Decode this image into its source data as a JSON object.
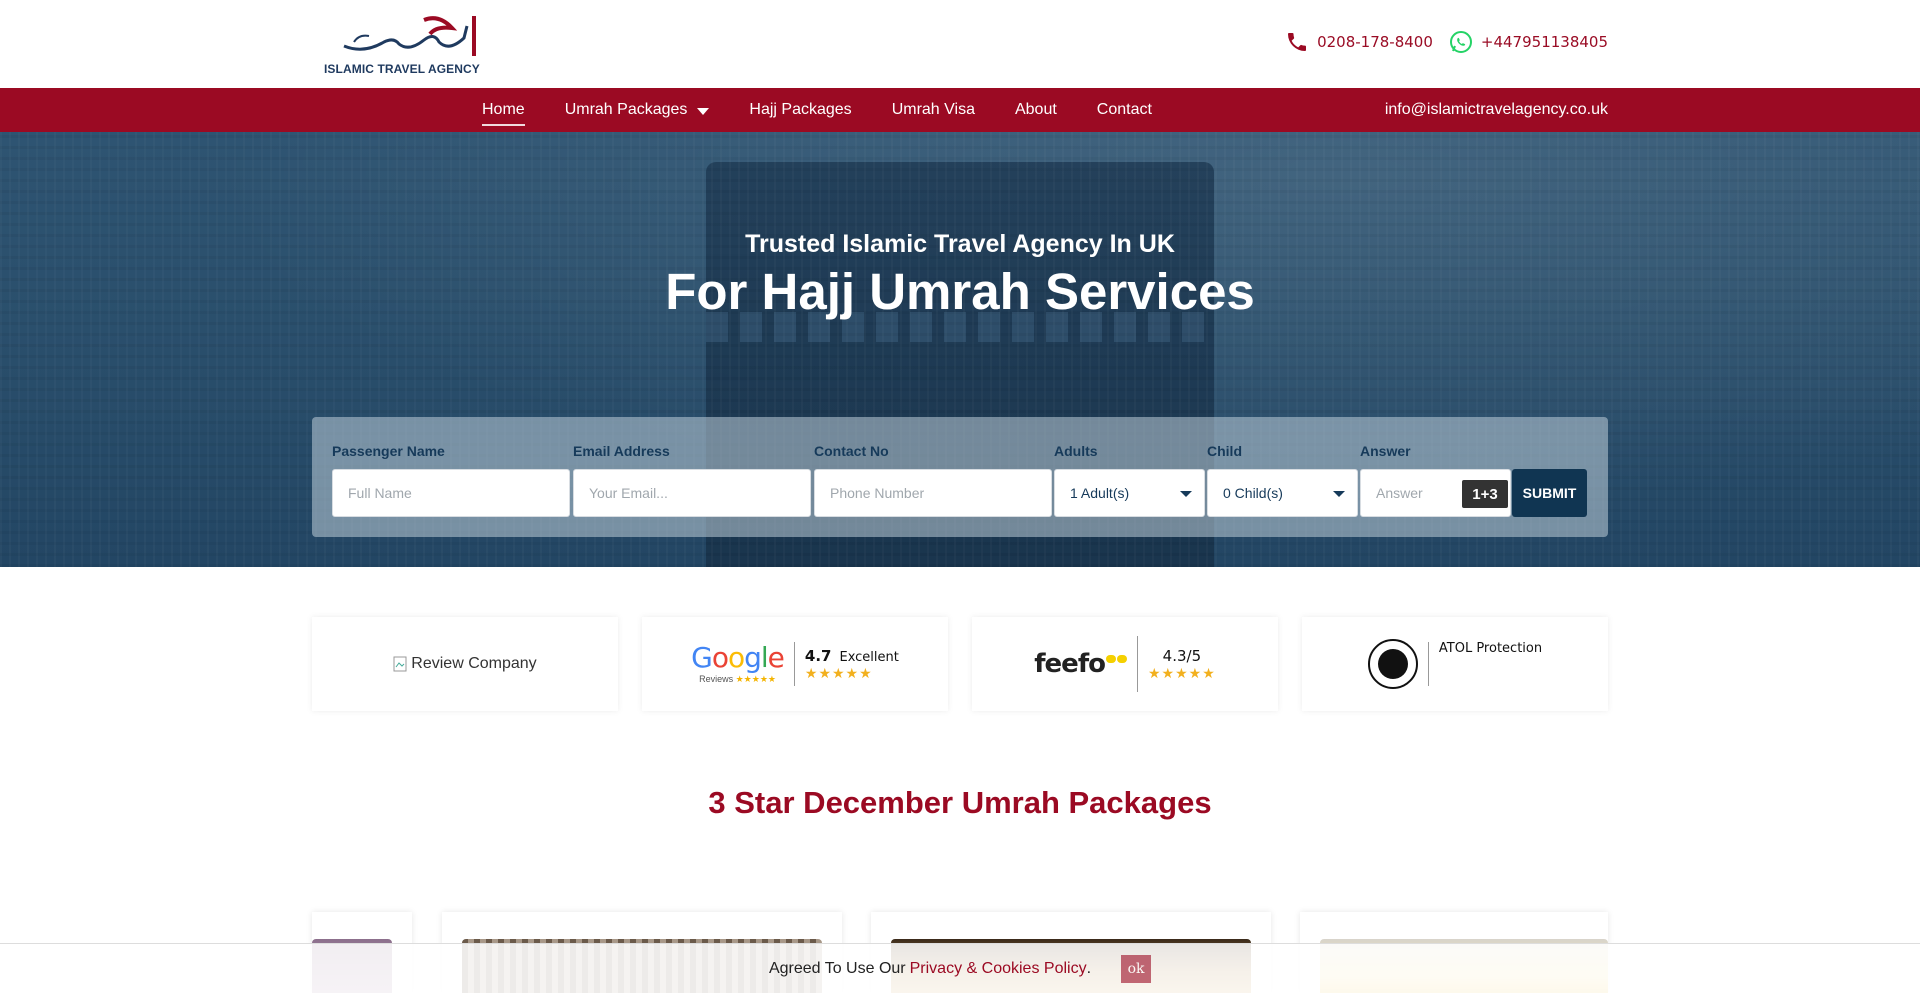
{
  "header": {
    "logo_text": "ISLAMIC TRAVEL AGENCY",
    "phone": "0208-178-8400",
    "whatsapp": "+447951138405"
  },
  "nav": {
    "items": [
      {
        "label": "Home",
        "active": true
      },
      {
        "label": "Umrah Packages",
        "dropdown": true
      },
      {
        "label": "Hajj Packages"
      },
      {
        "label": "Umrah Visa"
      },
      {
        "label": "About"
      },
      {
        "label": "Contact"
      }
    ],
    "email": "info@islamictravelagency.co.uk"
  },
  "hero": {
    "subtitle": "Trusted Islamic Travel Agency In UK",
    "title": "For Hajj Umrah Services"
  },
  "form": {
    "passenger_label": "Passenger Name",
    "passenger_placeholder": "Full Name",
    "email_label": "Email Address",
    "email_placeholder": "Your Email...",
    "contact_label": "Contact No",
    "contact_placeholder": "Phone Number",
    "adults_label": "Adults",
    "adults_value": "1 Adult(s)",
    "child_label": "Child",
    "child_value": "0 Child(s)",
    "answer_label": "Answer",
    "answer_placeholder": "Answer",
    "captcha": "1+3",
    "submit": "SUBMIT"
  },
  "reviews": {
    "broken_image_alt": "Review Company",
    "google": {
      "rating": "4.7",
      "label": "Excellent",
      "stars": "★★★★★",
      "sub": "Reviews"
    },
    "feefo": {
      "rating": "4.3/5",
      "stars": "★★★★★"
    },
    "atol": {
      "label": "ATOL Protection"
    }
  },
  "section": {
    "title": "3 Star December Umrah Packages"
  },
  "cookie": {
    "text": "Agreed To Use Our",
    "link": "Privacy & Cookies Policy",
    "period": ".",
    "ok": "ok"
  },
  "colors": {
    "brand": "#9b0a23",
    "navy": "#103552"
  }
}
